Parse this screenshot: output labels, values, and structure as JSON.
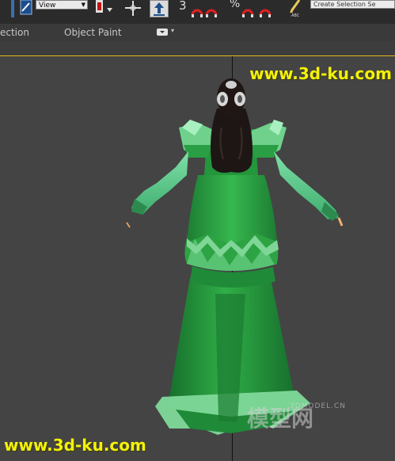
{
  "toolbar": {
    "view_dropdown": "View",
    "selection_set_placeholder": "Create Selection Se",
    "snap_label": "3",
    "percent_snap_label": "%"
  },
  "ribbon": {
    "tab_selection": "ection",
    "tab_object_paint": "Object Paint"
  },
  "watermarks": {
    "top": "www.3d-ku.com",
    "bottom": "www.3d-ku.com",
    "model_site_en": "3DMODEL.CN",
    "model_site_zh": "模型网"
  },
  "colors": {
    "viewport_bg": "#444444",
    "active_viewport_border": "#e4b51e",
    "dress_green": "#2eac45",
    "watermark_yellow": "#f3f20a"
  }
}
